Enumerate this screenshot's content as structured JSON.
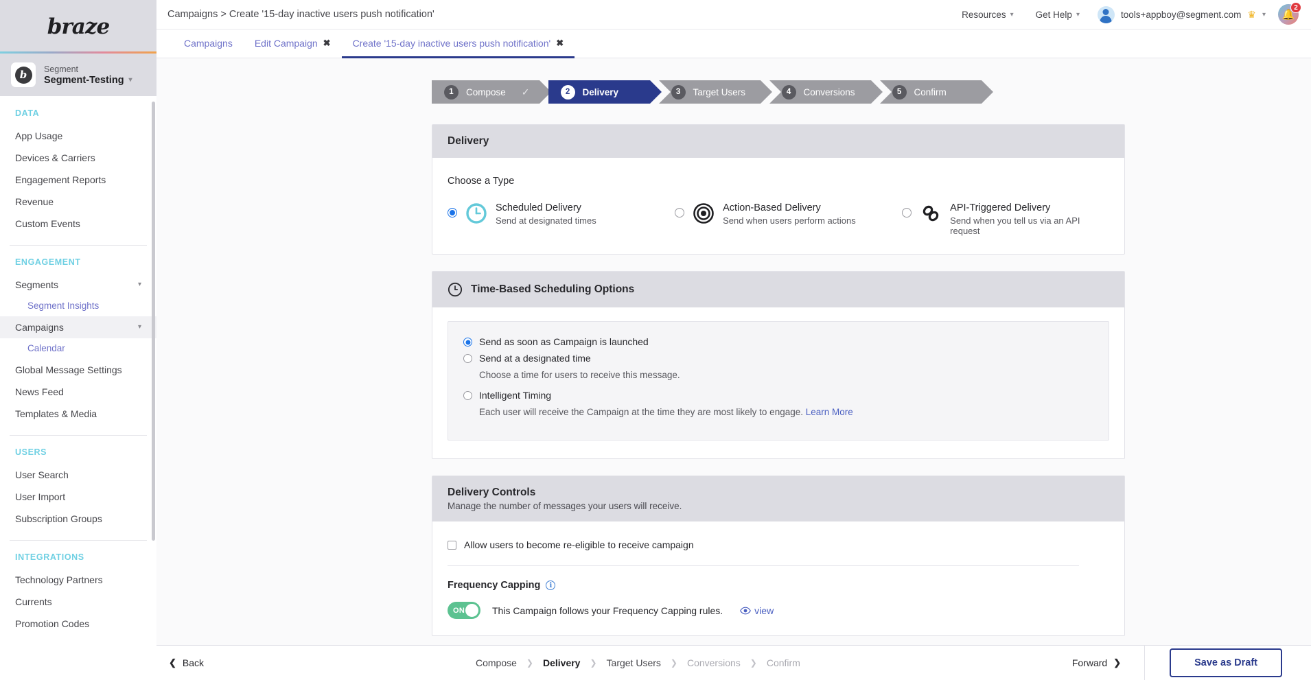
{
  "sidebar": {
    "logo": "braze",
    "workspace": {
      "label": "Segment",
      "name": "Segment-Testing",
      "avatar_letter": "b"
    },
    "sections": [
      {
        "title": "DATA",
        "items": [
          {
            "label": "App Usage"
          },
          {
            "label": "Devices & Carriers"
          },
          {
            "label": "Engagement Reports"
          },
          {
            "label": "Revenue"
          },
          {
            "label": "Custom Events"
          }
        ]
      },
      {
        "title": "ENGAGEMENT",
        "items": [
          {
            "label": "Segments",
            "expandable": true
          },
          {
            "label": "Segment Insights",
            "sub": true
          },
          {
            "label": "Campaigns",
            "expandable": true,
            "active": true
          },
          {
            "label": "Calendar",
            "sub": true
          },
          {
            "label": "Global Message Settings"
          },
          {
            "label": "News Feed"
          },
          {
            "label": "Templates & Media"
          }
        ]
      },
      {
        "title": "USERS",
        "items": [
          {
            "label": "User Search"
          },
          {
            "label": "User Import"
          },
          {
            "label": "Subscription Groups"
          }
        ]
      },
      {
        "title": "INTEGRATIONS",
        "items": [
          {
            "label": "Technology Partners"
          },
          {
            "label": "Currents"
          },
          {
            "label": "Promotion Codes"
          }
        ]
      }
    ]
  },
  "topbar": {
    "breadcrumb": "Campaigns > Create '15-day inactive users push notification'",
    "resources_label": "Resources",
    "help_label": "Get Help",
    "user_email": "tools+appboy@segment.com",
    "notification_count": "2"
  },
  "tabs": [
    {
      "label": "Campaigns",
      "closable": false,
      "active": false
    },
    {
      "label": "Edit Campaign",
      "closable": true,
      "active": false
    },
    {
      "label": "Create '15-day inactive users push notification'",
      "closable": true,
      "active": true
    }
  ],
  "stepper": [
    {
      "num": "1",
      "label": "Compose",
      "state": "done"
    },
    {
      "num": "2",
      "label": "Delivery",
      "state": "active"
    },
    {
      "num": "3",
      "label": "Target Users",
      "state": "todo"
    },
    {
      "num": "4",
      "label": "Conversions",
      "state": "todo"
    },
    {
      "num": "5",
      "label": "Confirm",
      "state": "todo"
    }
  ],
  "delivery": {
    "card_title": "Delivery",
    "choose_label": "Choose a Type",
    "types": [
      {
        "title": "Scheduled Delivery",
        "desc": "Send at designated times",
        "icon": "clock-icon",
        "selected": true
      },
      {
        "title": "Action-Based Delivery",
        "desc": "Send when users perform actions",
        "icon": "target-icon",
        "selected": false
      },
      {
        "title": "API-Triggered Delivery",
        "desc": "Send when you tell us via an API request",
        "icon": "link-icon",
        "selected": false
      }
    ]
  },
  "scheduling": {
    "card_title": "Time-Based Scheduling Options",
    "options": [
      {
        "label": "Send as soon as Campaign is launched",
        "desc": "",
        "selected": true
      },
      {
        "label": "Send at a designated time",
        "desc": "Choose a time for users to receive this message.",
        "selected": false
      },
      {
        "label": "Intelligent Timing",
        "desc": "Each user will receive the Campaign at the time they are most likely to engage.",
        "link": "Learn More",
        "selected": false
      }
    ]
  },
  "controls": {
    "card_title": "Delivery Controls",
    "card_sub": "Manage the number of messages your users will receive.",
    "reeligible_label": "Allow users to become re-eligible to receive campaign",
    "reeligible_checked": false,
    "frequency_title": "Frequency Capping",
    "toggle_state": "ON",
    "toggle_on": true,
    "frequency_text": "This Campaign follows your Frequency Capping rules.",
    "view_label": "view"
  },
  "footer": {
    "back_label": "Back",
    "forward_label": "Forward",
    "save_label": "Save as Draft",
    "steps": [
      {
        "label": "Compose",
        "state": "normal"
      },
      {
        "label": "Delivery",
        "state": "active"
      },
      {
        "label": "Target Users",
        "state": "normal"
      },
      {
        "label": "Conversions",
        "state": "muted"
      },
      {
        "label": "Confirm",
        "state": "muted"
      }
    ]
  },
  "colors": {
    "brand_blue": "#2a3a8c",
    "accent_cyan": "#6fd0e3",
    "link_purple": "#6f72c9",
    "toggle_green": "#5cc291",
    "badge_red": "#e0393e",
    "radio_blue": "#1a73e8"
  }
}
